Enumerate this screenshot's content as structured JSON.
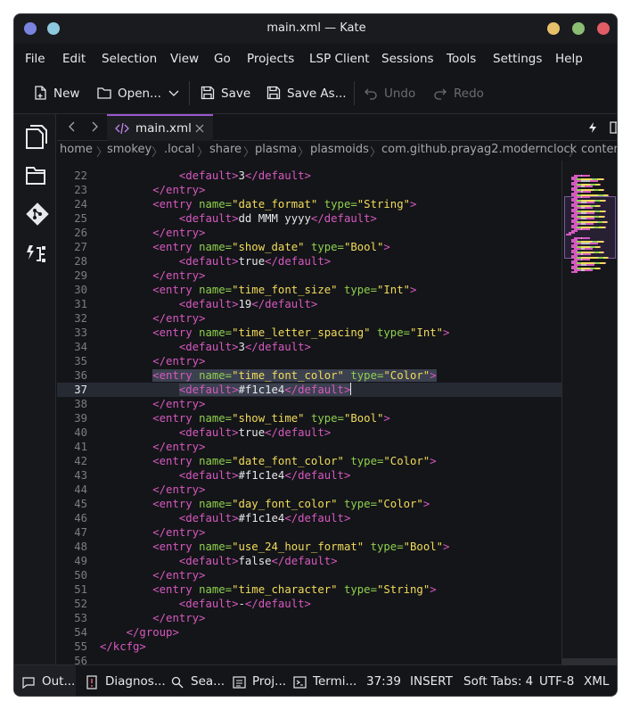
{
  "window": {
    "title": "main.xml — Kate"
  },
  "menu": [
    "File",
    "Edit",
    "Selection",
    "View",
    "Go",
    "Projects",
    "LSP Client",
    "Sessions",
    "Tools",
    "Settings",
    "Help"
  ],
  "toolbar": {
    "new_label": "New",
    "open_label": "Open...",
    "save_label": "Save",
    "save_as_label": "Save As...",
    "undo_label": "Undo",
    "redo_label": "Redo"
  },
  "tab": {
    "label": "main.xml"
  },
  "breadcrumb": [
    "home",
    "smokey",
    ".local",
    "share",
    "plasma",
    "plasmoids",
    "com.github.prayag2.modernclock",
    "conter"
  ],
  "editor": {
    "current_line": 37,
    "lines": [
      {
        "n": "22",
        "indent": 3,
        "parts": [
          [
            "t-tag",
            "<default>"
          ],
          [
            "t-txt",
            "3"
          ],
          [
            "t-tag",
            "</default>"
          ]
        ]
      },
      {
        "n": "23",
        "indent": 2,
        "parts": [
          [
            "t-tag",
            "</entry>"
          ]
        ]
      },
      {
        "n": "24",
        "indent": 2,
        "parts": [
          [
            "t-tag",
            "<entry "
          ],
          [
            "t-attr",
            "name="
          ],
          [
            "t-str",
            "\"date_format\""
          ],
          [
            "t-txt",
            " "
          ],
          [
            "t-attr",
            "type="
          ],
          [
            "t-str",
            "\"String\""
          ],
          [
            "t-tag",
            ">"
          ]
        ]
      },
      {
        "n": "25",
        "indent": 3,
        "parts": [
          [
            "t-tag",
            "<default>"
          ],
          [
            "t-txt",
            "dd MMM yyyy"
          ],
          [
            "t-tag",
            "</default>"
          ]
        ]
      },
      {
        "n": "26",
        "indent": 2,
        "parts": [
          [
            "t-tag",
            "</entry>"
          ]
        ]
      },
      {
        "n": "27",
        "indent": 2,
        "parts": [
          [
            "t-tag",
            "<entry "
          ],
          [
            "t-attr",
            "name="
          ],
          [
            "t-str",
            "\"show_date\""
          ],
          [
            "t-txt",
            " "
          ],
          [
            "t-attr",
            "type="
          ],
          [
            "t-str",
            "\"Bool\""
          ],
          [
            "t-tag",
            ">"
          ]
        ]
      },
      {
        "n": "28",
        "indent": 3,
        "parts": [
          [
            "t-tag",
            "<default>"
          ],
          [
            "t-txt",
            "true"
          ],
          [
            "t-tag",
            "</default>"
          ]
        ]
      },
      {
        "n": "29",
        "indent": 2,
        "parts": [
          [
            "t-tag",
            "</entry>"
          ]
        ]
      },
      {
        "n": "30",
        "indent": 2,
        "parts": [
          [
            "t-tag",
            "<entry "
          ],
          [
            "t-attr",
            "name="
          ],
          [
            "t-str",
            "\"time_font_size\""
          ],
          [
            "t-txt",
            " "
          ],
          [
            "t-attr",
            "type="
          ],
          [
            "t-str",
            "\"Int\""
          ],
          [
            "t-tag",
            ">"
          ]
        ]
      },
      {
        "n": "31",
        "indent": 3,
        "parts": [
          [
            "t-tag",
            "<default>"
          ],
          [
            "t-txt",
            "19"
          ],
          [
            "t-tag",
            "</default>"
          ]
        ]
      },
      {
        "n": "32",
        "indent": 2,
        "parts": [
          [
            "t-tag",
            "</entry>"
          ]
        ]
      },
      {
        "n": "33",
        "indent": 2,
        "parts": [
          [
            "t-tag",
            "<entry "
          ],
          [
            "t-attr",
            "name="
          ],
          [
            "t-str",
            "\"time_letter_spacing\""
          ],
          [
            "t-txt",
            " "
          ],
          [
            "t-attr",
            "type="
          ],
          [
            "t-str",
            "\"Int\""
          ],
          [
            "t-tag",
            ">"
          ]
        ]
      },
      {
        "n": "34",
        "indent": 3,
        "parts": [
          [
            "t-tag",
            "<default>"
          ],
          [
            "t-txt",
            "3"
          ],
          [
            "t-tag",
            "</default>"
          ]
        ]
      },
      {
        "n": "35",
        "indent": 2,
        "parts": [
          [
            "t-tag",
            "</entry>"
          ]
        ]
      },
      {
        "n": "36",
        "indent": 2,
        "sel": true,
        "parts": [
          [
            "t-tag",
            "<entry "
          ],
          [
            "t-attr",
            "name="
          ],
          [
            "t-str",
            "\"time_font_color\""
          ],
          [
            "t-txt",
            " "
          ],
          [
            "t-attr",
            "type="
          ],
          [
            "t-str",
            "\"Color\""
          ],
          [
            "t-tag",
            ">"
          ]
        ]
      },
      {
        "n": "37",
        "indent": 3,
        "sel": true,
        "cursor": true,
        "parts": [
          [
            "t-tag",
            "<default>"
          ],
          [
            "t-txt",
            "#f1c1e4"
          ],
          [
            "t-tag",
            "</default>"
          ]
        ]
      },
      {
        "n": "38",
        "indent": 2,
        "parts": [
          [
            "t-tag",
            "</entry>"
          ]
        ]
      },
      {
        "n": "39",
        "indent": 2,
        "parts": [
          [
            "t-tag",
            "<entry "
          ],
          [
            "t-attr",
            "name="
          ],
          [
            "t-str",
            "\"show_time\""
          ],
          [
            "t-txt",
            " "
          ],
          [
            "t-attr",
            "type="
          ],
          [
            "t-str",
            "\"Bool\""
          ],
          [
            "t-tag",
            ">"
          ]
        ]
      },
      {
        "n": "40",
        "indent": 3,
        "parts": [
          [
            "t-tag",
            "<default>"
          ],
          [
            "t-txt",
            "true"
          ],
          [
            "t-tag",
            "</default>"
          ]
        ]
      },
      {
        "n": "41",
        "indent": 2,
        "parts": [
          [
            "t-tag",
            "</entry>"
          ]
        ]
      },
      {
        "n": "42",
        "indent": 2,
        "parts": [
          [
            "t-tag",
            "<entry "
          ],
          [
            "t-attr",
            "name="
          ],
          [
            "t-str",
            "\"date_font_color\""
          ],
          [
            "t-txt",
            " "
          ],
          [
            "t-attr",
            "type="
          ],
          [
            "t-str",
            "\"Color\""
          ],
          [
            "t-tag",
            ">"
          ]
        ]
      },
      {
        "n": "43",
        "indent": 3,
        "parts": [
          [
            "t-tag",
            "<default>"
          ],
          [
            "t-txt",
            "#f1c1e4"
          ],
          [
            "t-tag",
            "</default>"
          ]
        ]
      },
      {
        "n": "44",
        "indent": 2,
        "parts": [
          [
            "t-tag",
            "</entry>"
          ]
        ]
      },
      {
        "n": "45",
        "indent": 2,
        "parts": [
          [
            "t-tag",
            "<entry "
          ],
          [
            "t-attr",
            "name="
          ],
          [
            "t-str",
            "\"day_font_color\""
          ],
          [
            "t-txt",
            " "
          ],
          [
            "t-attr",
            "type="
          ],
          [
            "t-str",
            "\"Color\""
          ],
          [
            "t-tag",
            ">"
          ]
        ]
      },
      {
        "n": "46",
        "indent": 3,
        "parts": [
          [
            "t-tag",
            "<default>"
          ],
          [
            "t-txt",
            "#f1c1e4"
          ],
          [
            "t-tag",
            "</default>"
          ]
        ]
      },
      {
        "n": "47",
        "indent": 2,
        "parts": [
          [
            "t-tag",
            "</entry>"
          ]
        ]
      },
      {
        "n": "48",
        "indent": 2,
        "parts": [
          [
            "t-tag",
            "<entry "
          ],
          [
            "t-attr",
            "name="
          ],
          [
            "t-str",
            "\"use_24_hour_format\""
          ],
          [
            "t-txt",
            " "
          ],
          [
            "t-attr",
            "type="
          ],
          [
            "t-str",
            "\"Bool\""
          ],
          [
            "t-tag",
            ">"
          ]
        ]
      },
      {
        "n": "49",
        "indent": 3,
        "parts": [
          [
            "t-tag",
            "<default>"
          ],
          [
            "t-txt",
            "false"
          ],
          [
            "t-tag",
            "</default>"
          ]
        ]
      },
      {
        "n": "50",
        "indent": 2,
        "parts": [
          [
            "t-tag",
            "</entry>"
          ]
        ]
      },
      {
        "n": "51",
        "indent": 2,
        "parts": [
          [
            "t-tag",
            "<entry "
          ],
          [
            "t-attr",
            "name="
          ],
          [
            "t-str",
            "\"time_character\""
          ],
          [
            "t-txt",
            " "
          ],
          [
            "t-attr",
            "type="
          ],
          [
            "t-str",
            "\"String\""
          ],
          [
            "t-tag",
            ">"
          ]
        ]
      },
      {
        "n": "52",
        "indent": 3,
        "parts": [
          [
            "t-tag",
            "<default>"
          ],
          [
            "t-txt",
            "-"
          ],
          [
            "t-tag",
            "</default>"
          ]
        ]
      },
      {
        "n": "53",
        "indent": 2,
        "parts": [
          [
            "t-tag",
            "</entry>"
          ]
        ]
      },
      {
        "n": "54",
        "indent": 1,
        "parts": [
          [
            "t-tag",
            "</group>"
          ]
        ]
      },
      {
        "n": "55",
        "indent": 0,
        "parts": [
          [
            "t-tag",
            "</kcfg>"
          ]
        ]
      },
      {
        "n": "56",
        "indent": 0,
        "parts": []
      }
    ]
  },
  "statusbar": {
    "output_label": "Out...",
    "diagnostics_label": "Diagnos...",
    "search_label": "Sea...",
    "projects_label": "Proj...",
    "terminal_label": "Termi...",
    "position": "37:39",
    "mode": "INSERT",
    "indent": "Soft Tabs: 4",
    "encoding": "UTF-8",
    "syntax": "XML"
  },
  "colors": {
    "tag": "#d659c1",
    "attr": "#8fd04f",
    "string": "#f1dc5c",
    "accent": "#9b59d0"
  }
}
